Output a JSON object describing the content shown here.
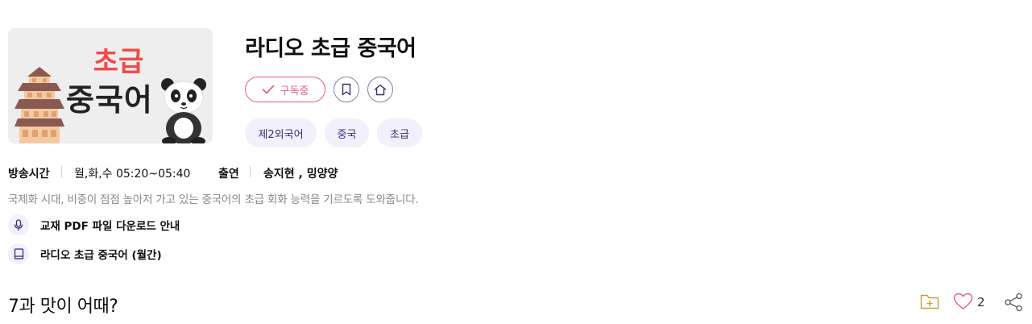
{
  "program": {
    "title": "라디오 초급 중국어",
    "thumbnail": {
      "line1": "초급",
      "line2": "중국어"
    },
    "subscribe_label": "구독중",
    "tags": [
      "제2외국어",
      "중국",
      "초급"
    ],
    "broadcast_label": "방송시간",
    "broadcast_time": "월,화,수 05:20~05:40",
    "cast_label": "출연",
    "cast": "송지현 , 밍양양",
    "description": "국제화 시대, 비중이 점점 높아저 가고 있는 중국어의 초급 회화 능력을 기르도록 도와줍니다.",
    "links": [
      {
        "icon": "microphone-icon",
        "label": "교재 PDF 파일 다운로드 안내"
      },
      {
        "icon": "book-icon",
        "label": "라디오 초급 중국어 (월간)"
      }
    ]
  },
  "episode": {
    "title": "7과 맛이 어때?",
    "like_count": "2"
  },
  "colors": {
    "accent_pink": "#ea5b8f",
    "accent_purple": "#3b2a78",
    "tag_bg": "#f2f0fa",
    "folder_icon": "#c9a227"
  }
}
